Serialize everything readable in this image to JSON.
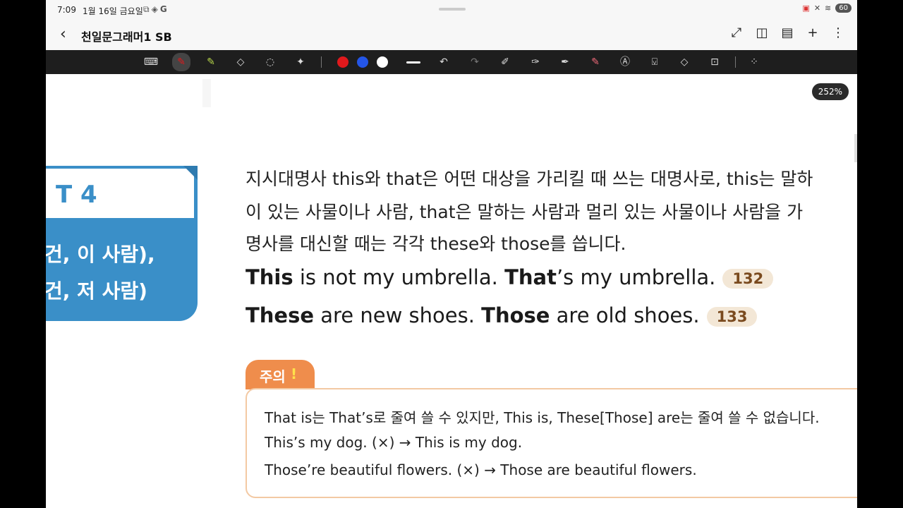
{
  "status": {
    "time": "7:09",
    "date": "1월 16일 금요일",
    "icons": [
      "screen-icon",
      "diamond-icon",
      "g-icon"
    ],
    "right_icons": [
      "cast-icon",
      "mute-icon",
      "wifi-icon"
    ],
    "battery": "60"
  },
  "titlebar": {
    "title": "천일문그래머1 SB",
    "actions": [
      "expand-icon",
      "book-icon",
      "page-edit-icon",
      "plus-icon",
      "more-icon"
    ]
  },
  "toolbar": {
    "colors": [
      "#e0191c",
      "#2456e8",
      "#ffffff"
    ],
    "tools": [
      "keyboard",
      "pen",
      "highlighter",
      "eraser",
      "lasso",
      "magic",
      "undo",
      "redo",
      "pen-settings",
      "shape",
      "text-pen",
      "marker",
      "text-a",
      "text-box",
      "shape-fill",
      "lock",
      "more"
    ]
  },
  "zoom": "252%",
  "card": {
    "number": "T 4",
    "line1": "건, 이 사람),",
    "line2": "건, 저 사람)"
  },
  "main": {
    "para1": "지시대명사 this와 that은 어떤 대상을 가리킬 때 쓰는 대명사로, this는 말하",
    "para2": "이 있는 사물이나 사람, that은 말하는 사람과 멀리 있는 사물이나 사람을 가",
    "para3": "명사를 대신할 때는 각각 these와 those를 씁니다.",
    "ex1": {
      "b1": "This",
      "t1": " is not my umbrella. ",
      "b2": "That",
      "t2": "’s my umbrella.",
      "num": "132"
    },
    "ex2": {
      "b1": "These",
      "t1": " are new shoes. ",
      "b2": "Those",
      "t2": " are old shoes.",
      "num": "133"
    }
  },
  "note": {
    "tab": "주의",
    "bang": "!",
    "line1": "That is는 That’s로 줄여 쓸 수 있지만, This is, These[Those] are는 줄여 쓸 수 없습니다.",
    "line2": "This’s my dog. (×) → This is my dog.",
    "line3": "Those’re beautiful flowers. (×) → Those are beautiful flowers."
  }
}
